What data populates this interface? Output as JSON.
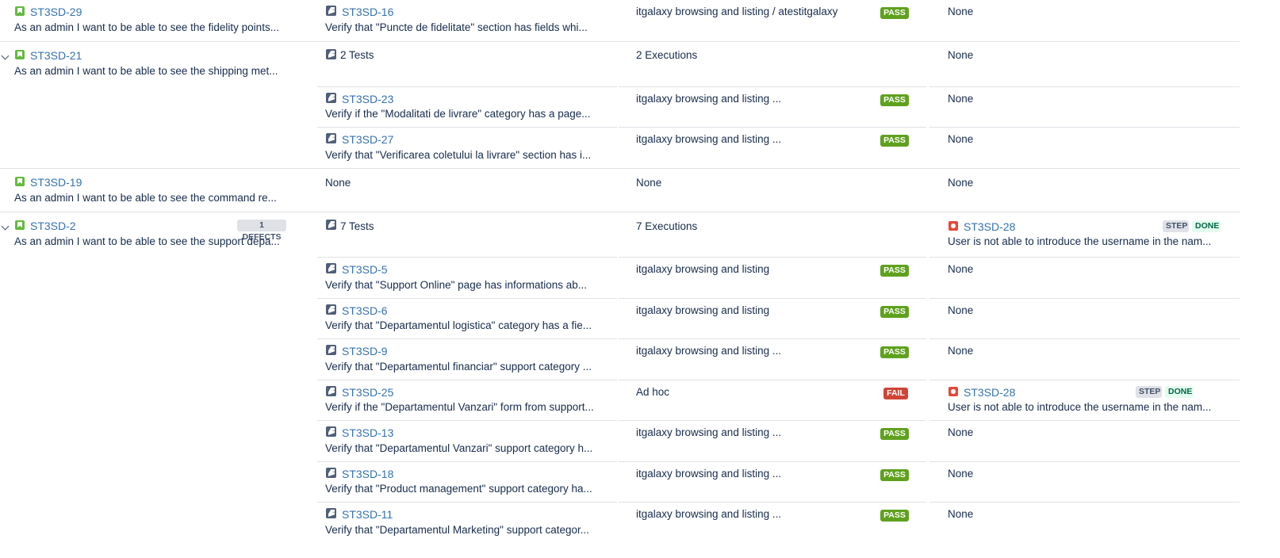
{
  "stories": [
    {
      "key": "ST3SD-29",
      "summary": "As an admin I want to be able to see the fidelity points..."
    },
    {
      "key": "ST3SD-21",
      "summary": "As an admin I want to be able to see the shipping met..."
    },
    {
      "key": "ST3SD-19",
      "summary": "As an admin I want to be able to see the command re..."
    },
    {
      "key": "ST3SD-2",
      "summary": "As an admin I want to be able to see the support depa...",
      "defects": "1 DEFECTS"
    }
  ],
  "tests": [
    {
      "key": "ST3SD-16",
      "summary": "Verify that \"Puncte de fidelitate\" section has fields whi...",
      "execution": "itgalaxy browsing and listing / atestitgalaxy",
      "status": "PASS",
      "defect": "None"
    },
    {
      "summary_count": "2 Tests",
      "execution": "2 Executions",
      "defect": "None"
    },
    {
      "key": "ST3SD-23",
      "summary": "Verify if the \"Modalitati de livrare\" category has a page...",
      "execution": "itgalaxy browsing and listing ...",
      "status": "PASS",
      "defect": "None"
    },
    {
      "key": "ST3SD-27",
      "summary": "Verify that \"Verificarea coletului la livrare\" section has i...",
      "execution": "itgalaxy browsing and listing ...",
      "status": "PASS",
      "defect": "None"
    },
    {
      "none": "None",
      "execution": "None",
      "defect": "None"
    },
    {
      "summary_count": "7 Tests",
      "execution": "7 Executions",
      "defect_key": "ST3SD-28",
      "defect_summary": "User is not able to introduce the username in the nam...",
      "step": "STEP",
      "done": "DONE"
    },
    {
      "key": "ST3SD-5",
      "summary": "Verify that \"Support Online\" page has informations ab...",
      "execution": "itgalaxy browsing and listing",
      "status": "PASS",
      "defect": "None"
    },
    {
      "key": "ST3SD-6",
      "summary": "Verify that \"Departamentul logistica\" category has a fie...",
      "execution": "itgalaxy browsing and listing",
      "status": "PASS",
      "defect": "None"
    },
    {
      "key": "ST3SD-9",
      "summary": "Verify that \"Departamentul financiar\" support category ...",
      "execution": "itgalaxy browsing and listing ...",
      "status": "PASS",
      "defect": "None"
    },
    {
      "key": "ST3SD-25",
      "summary": "Verify if the \"Departamentul Vanzari\" form from support...",
      "execution": "Ad hoc",
      "status": "FAIL",
      "defect_key": "ST3SD-28",
      "defect_summary": "User is not able to introduce the username in the nam...",
      "step": "STEP",
      "done": "DONE"
    },
    {
      "key": "ST3SD-13",
      "summary": "Verify that \"Departamentul Vanzari\" support category h...",
      "execution": "itgalaxy browsing and listing ...",
      "status": "PASS",
      "defect": "None"
    },
    {
      "key": "ST3SD-18",
      "summary": "Verify that \"Product management\" support category ha...",
      "execution": "itgalaxy browsing and listing ...",
      "status": "PASS",
      "defect": "None"
    },
    {
      "key": "ST3SD-11",
      "summary": "Verify that \"Departamentul Marketing\" support categor...",
      "execution": "itgalaxy browsing and listing ...",
      "status": "PASS",
      "defect": "None"
    }
  ],
  "colors": {
    "pass": "#5fa11e",
    "fail": "#d04437",
    "link": "#3572b0",
    "story_icon": "#63ba3c",
    "bug_icon": "#e5493a"
  },
  "icons": {
    "story": "story-icon",
    "test": "test-icon",
    "bug": "bug-icon",
    "expand": "chevron-down-icon"
  }
}
